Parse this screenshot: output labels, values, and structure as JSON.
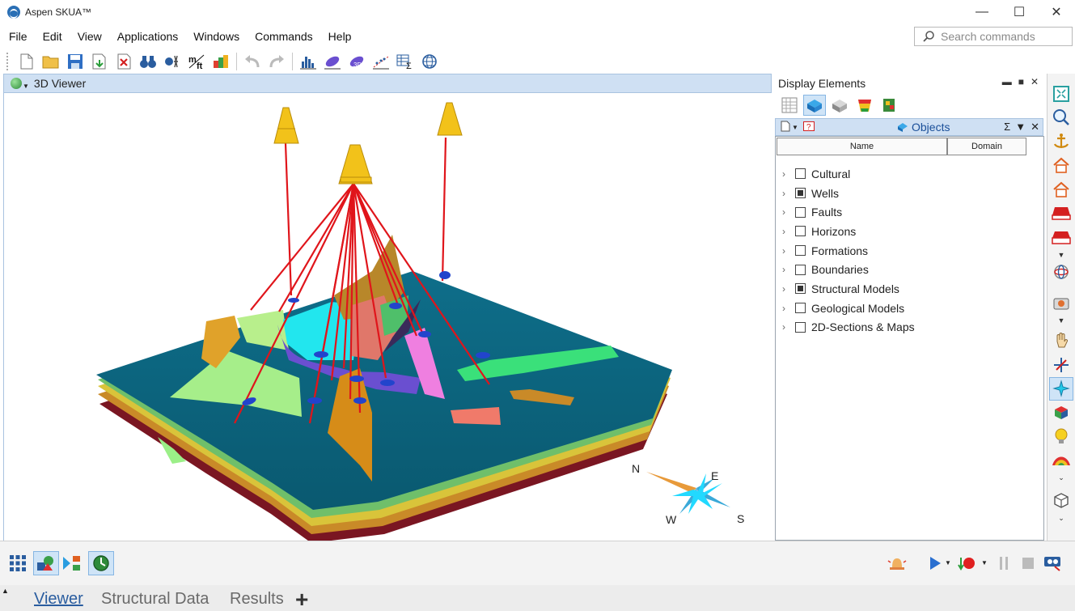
{
  "window": {
    "title": "Aspen SKUA™",
    "controls": [
      "—",
      "☐",
      "✕"
    ]
  },
  "menu": [
    "File",
    "Edit",
    "View",
    "Applications",
    "Windows",
    "Commands",
    "Help"
  ],
  "search": {
    "placeholder": "Search commands"
  },
  "viewer": {
    "title": "3D Viewer"
  },
  "compass": {
    "n": "N",
    "e": "E",
    "w": "W",
    "s": "S"
  },
  "display_elements": {
    "title": "Display Elements",
    "objects_title": "Objects",
    "columns": [
      "Name",
      "Domain"
    ],
    "items": [
      {
        "label": "Cultural",
        "checked": false
      },
      {
        "label": "Wells",
        "checked": true
      },
      {
        "label": "Faults",
        "checked": false
      },
      {
        "label": "Horizons",
        "checked": false
      },
      {
        "label": "Formations",
        "checked": false
      },
      {
        "label": "Boundaries",
        "checked": false
      },
      {
        "label": "Structural Models",
        "checked": true
      },
      {
        "label": "Geological Models",
        "checked": false
      },
      {
        "label": "2D-Sections & Maps",
        "checked": false
      }
    ]
  },
  "tabs": [
    {
      "label": "Viewer",
      "active": true
    },
    {
      "label": "Structural Data",
      "active": false
    },
    {
      "label": "Results",
      "active": false
    }
  ],
  "tab_add": "+",
  "colors": {
    "accent": "#2a5d9f",
    "panel_header": "#cfe0f3",
    "horizon_top": "#0f6f8a",
    "well_path": "#e0151b",
    "rig": "#f2c21a"
  }
}
